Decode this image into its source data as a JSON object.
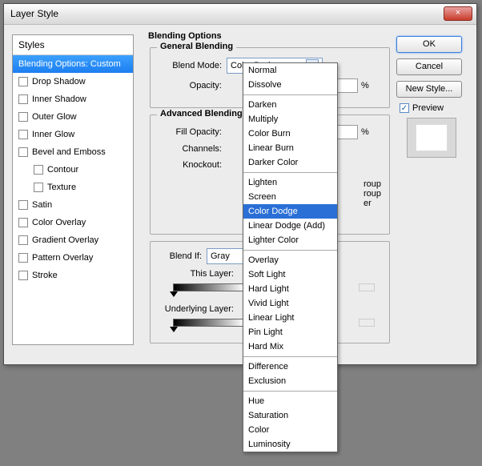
{
  "titlebar": {
    "title": "Layer Style",
    "close": "×"
  },
  "styles_panel": {
    "header": "Styles",
    "selected": "Blending Options: Custom",
    "items": [
      "Drop Shadow",
      "Inner Shadow",
      "Outer Glow",
      "Inner Glow",
      "Bevel and Emboss",
      "Contour",
      "Texture",
      "Satin",
      "Color Overlay",
      "Gradient Overlay",
      "Pattern Overlay",
      "Stroke"
    ]
  },
  "blend_title": "Blending Options",
  "general": {
    "legend": "General Blending",
    "mode_label": "Blend Mode:",
    "mode_value": "Color Dodge",
    "opacity_label": "Opacity:",
    "opacity_unit": "%"
  },
  "advanced": {
    "legend": "Advanced Blending",
    "fill_label": "Fill Opacity:",
    "fill_unit": "%",
    "channels_label": "Channels:",
    "knockout_label": "Knockout:",
    "grouptail1": "roup",
    "grouptail2": "roup",
    "tail3": "er"
  },
  "blendif": {
    "label": "Blend If:",
    "value": "Gray",
    "this_layer": "This Layer:",
    "under_layer": "Underlying Layer:"
  },
  "buttons": {
    "ok": "OK",
    "cancel": "Cancel",
    "newstyle": "New Style...",
    "preview": "Preview"
  },
  "dropdown": {
    "groups": [
      [
        "Normal",
        "Dissolve"
      ],
      [
        "Darken",
        "Multiply",
        "Color Burn",
        "Linear Burn",
        "Darker Color"
      ],
      [
        "Lighten",
        "Screen",
        "Color Dodge",
        "Linear Dodge (Add)",
        "Lighter Color"
      ],
      [
        "Overlay",
        "Soft Light",
        "Hard Light",
        "Vivid Light",
        "Linear Light",
        "Pin Light",
        "Hard Mix"
      ],
      [
        "Difference",
        "Exclusion"
      ],
      [
        "Hue",
        "Saturation",
        "Color",
        "Luminosity"
      ]
    ],
    "selected": "Color Dodge"
  }
}
